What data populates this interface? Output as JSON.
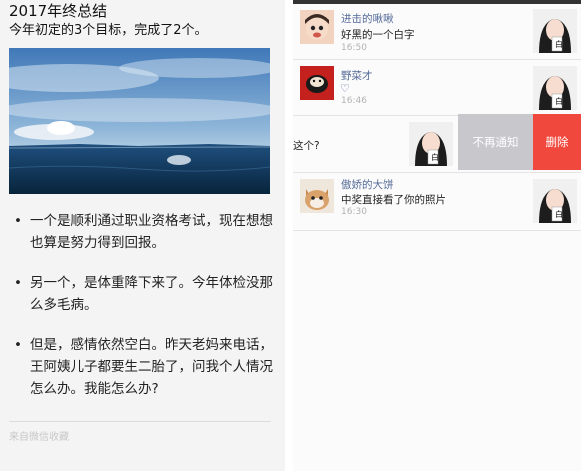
{
  "article": {
    "title": "2017年终总结",
    "subtitle": "今年初定的3个目标，完成了2个。",
    "bullets": [
      {
        "marker": "•",
        "text": "一个是顺利通过职业资格考试，现在想想也算是努力得到回报。"
      },
      {
        "marker": "•",
        "text": "另一个，是体重降下来了。今年体检没那么多毛病。"
      },
      {
        "marker": "•",
        "text": "但是，感情依然空白。昨天老妈来电话，王阿姨儿子都要生二胎了，问我个人情况怎么办。我能怎么办?"
      }
    ],
    "source": "来自微信收藏"
  },
  "notifications": [
    {
      "nick": "进击的啾啾",
      "message": "好黑的一个白字",
      "time": "16:50"
    },
    {
      "nick": "野菜才",
      "message_icon": "heart-outline-icon",
      "time": "16:46"
    },
    {
      "message": "这个?"
    },
    {
      "nick": "傲娇的大饼",
      "message": "中奖直接看了你的照片",
      "time": "16:30"
    }
  ],
  "swipe_actions": {
    "mute_label": "不再通知",
    "delete_label": "删除",
    "mute_color": "#c7c7cc",
    "delete_color": "#f0483c"
  },
  "colors": {
    "nickname": "#556b98",
    "time": "#b2b2b2"
  }
}
